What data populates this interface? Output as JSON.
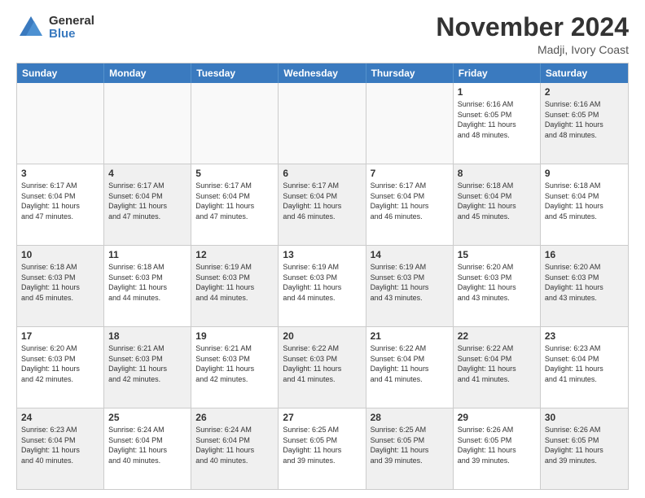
{
  "logo": {
    "general": "General",
    "blue": "Blue"
  },
  "title": "November 2024",
  "location": "Madji, Ivory Coast",
  "days_header": [
    "Sunday",
    "Monday",
    "Tuesday",
    "Wednesday",
    "Thursday",
    "Friday",
    "Saturday"
  ],
  "weeks": [
    [
      {
        "day": "",
        "info": "",
        "empty": true
      },
      {
        "day": "",
        "info": "",
        "empty": true
      },
      {
        "day": "",
        "info": "",
        "empty": true
      },
      {
        "day": "",
        "info": "",
        "empty": true
      },
      {
        "day": "",
        "info": "",
        "empty": true
      },
      {
        "day": "1",
        "info": "Sunrise: 6:16 AM\nSunset: 6:05 PM\nDaylight: 11 hours\nand 48 minutes."
      },
      {
        "day": "2",
        "info": "Sunrise: 6:16 AM\nSunset: 6:05 PM\nDaylight: 11 hours\nand 48 minutes.",
        "shaded": true
      }
    ],
    [
      {
        "day": "3",
        "info": "Sunrise: 6:17 AM\nSunset: 6:04 PM\nDaylight: 11 hours\nand 47 minutes."
      },
      {
        "day": "4",
        "info": "Sunrise: 6:17 AM\nSunset: 6:04 PM\nDaylight: 11 hours\nand 47 minutes.",
        "shaded": true
      },
      {
        "day": "5",
        "info": "Sunrise: 6:17 AM\nSunset: 6:04 PM\nDaylight: 11 hours\nand 47 minutes."
      },
      {
        "day": "6",
        "info": "Sunrise: 6:17 AM\nSunset: 6:04 PM\nDaylight: 11 hours\nand 46 minutes.",
        "shaded": true
      },
      {
        "day": "7",
        "info": "Sunrise: 6:17 AM\nSunset: 6:04 PM\nDaylight: 11 hours\nand 46 minutes."
      },
      {
        "day": "8",
        "info": "Sunrise: 6:18 AM\nSunset: 6:04 PM\nDaylight: 11 hours\nand 45 minutes.",
        "shaded": true
      },
      {
        "day": "9",
        "info": "Sunrise: 6:18 AM\nSunset: 6:04 PM\nDaylight: 11 hours\nand 45 minutes."
      }
    ],
    [
      {
        "day": "10",
        "info": "Sunrise: 6:18 AM\nSunset: 6:03 PM\nDaylight: 11 hours\nand 45 minutes.",
        "shaded": true
      },
      {
        "day": "11",
        "info": "Sunrise: 6:18 AM\nSunset: 6:03 PM\nDaylight: 11 hours\nand 44 minutes."
      },
      {
        "day": "12",
        "info": "Sunrise: 6:19 AM\nSunset: 6:03 PM\nDaylight: 11 hours\nand 44 minutes.",
        "shaded": true
      },
      {
        "day": "13",
        "info": "Sunrise: 6:19 AM\nSunset: 6:03 PM\nDaylight: 11 hours\nand 44 minutes."
      },
      {
        "day": "14",
        "info": "Sunrise: 6:19 AM\nSunset: 6:03 PM\nDaylight: 11 hours\nand 43 minutes.",
        "shaded": true
      },
      {
        "day": "15",
        "info": "Sunrise: 6:20 AM\nSunset: 6:03 PM\nDaylight: 11 hours\nand 43 minutes."
      },
      {
        "day": "16",
        "info": "Sunrise: 6:20 AM\nSunset: 6:03 PM\nDaylight: 11 hours\nand 43 minutes.",
        "shaded": true
      }
    ],
    [
      {
        "day": "17",
        "info": "Sunrise: 6:20 AM\nSunset: 6:03 PM\nDaylight: 11 hours\nand 42 minutes."
      },
      {
        "day": "18",
        "info": "Sunrise: 6:21 AM\nSunset: 6:03 PM\nDaylight: 11 hours\nand 42 minutes.",
        "shaded": true
      },
      {
        "day": "19",
        "info": "Sunrise: 6:21 AM\nSunset: 6:03 PM\nDaylight: 11 hours\nand 42 minutes."
      },
      {
        "day": "20",
        "info": "Sunrise: 6:22 AM\nSunset: 6:03 PM\nDaylight: 11 hours\nand 41 minutes.",
        "shaded": true
      },
      {
        "day": "21",
        "info": "Sunrise: 6:22 AM\nSunset: 6:04 PM\nDaylight: 11 hours\nand 41 minutes."
      },
      {
        "day": "22",
        "info": "Sunrise: 6:22 AM\nSunset: 6:04 PM\nDaylight: 11 hours\nand 41 minutes.",
        "shaded": true
      },
      {
        "day": "23",
        "info": "Sunrise: 6:23 AM\nSunset: 6:04 PM\nDaylight: 11 hours\nand 41 minutes."
      }
    ],
    [
      {
        "day": "24",
        "info": "Sunrise: 6:23 AM\nSunset: 6:04 PM\nDaylight: 11 hours\nand 40 minutes.",
        "shaded": true
      },
      {
        "day": "25",
        "info": "Sunrise: 6:24 AM\nSunset: 6:04 PM\nDaylight: 11 hours\nand 40 minutes."
      },
      {
        "day": "26",
        "info": "Sunrise: 6:24 AM\nSunset: 6:04 PM\nDaylight: 11 hours\nand 40 minutes.",
        "shaded": true
      },
      {
        "day": "27",
        "info": "Sunrise: 6:25 AM\nSunset: 6:05 PM\nDaylight: 11 hours\nand 39 minutes."
      },
      {
        "day": "28",
        "info": "Sunrise: 6:25 AM\nSunset: 6:05 PM\nDaylight: 11 hours\nand 39 minutes.",
        "shaded": true
      },
      {
        "day": "29",
        "info": "Sunrise: 6:26 AM\nSunset: 6:05 PM\nDaylight: 11 hours\nand 39 minutes."
      },
      {
        "day": "30",
        "info": "Sunrise: 6:26 AM\nSunset: 6:05 PM\nDaylight: 11 hours\nand 39 minutes.",
        "shaded": true
      }
    ]
  ]
}
